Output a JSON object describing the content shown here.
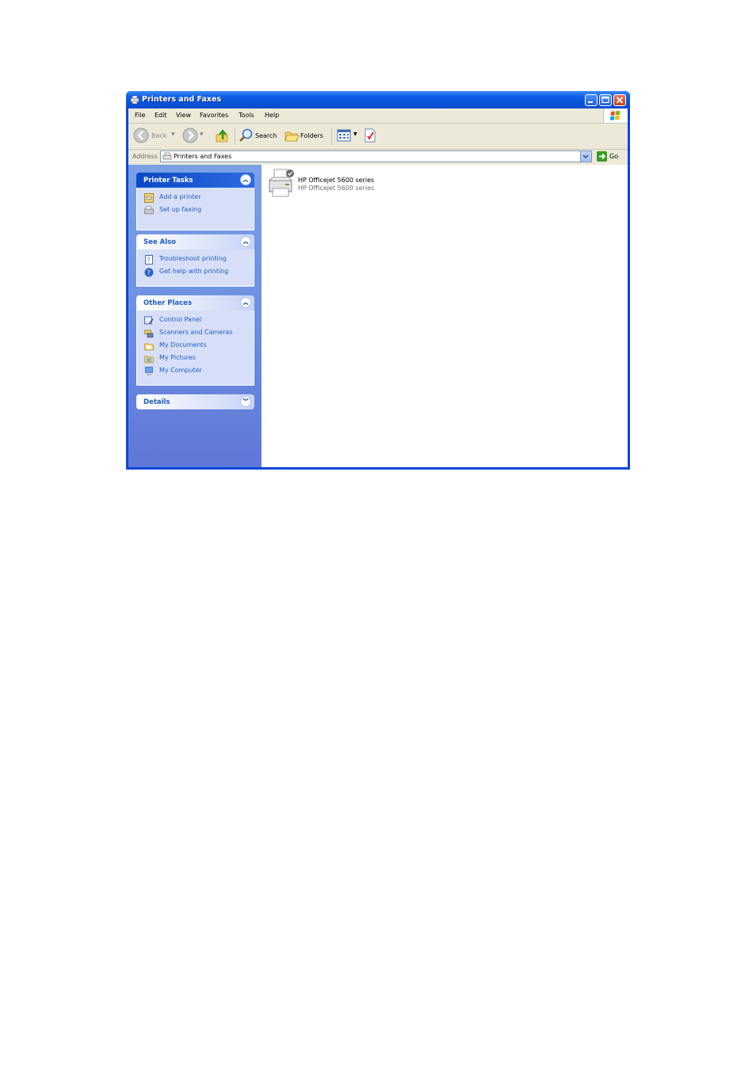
{
  "window": {
    "title": "Printers and Faxes"
  },
  "menu": [
    "File",
    "Edit",
    "View",
    "Favorites",
    "Tools",
    "Help"
  ],
  "toolbar": {
    "back": "Back",
    "search": "Search",
    "folders": "Folders"
  },
  "address": {
    "label": "Address",
    "value": "Printers and Faxes",
    "go": "Go"
  },
  "panels": {
    "printer_tasks": {
      "title": "Printer Tasks",
      "items": [
        "Add a printer",
        "Set up faxing"
      ]
    },
    "see_also": {
      "title": "See Also",
      "items": [
        "Troubleshoot printing",
        "Get help with printing"
      ]
    },
    "other_places": {
      "title": "Other Places",
      "items": [
        "Control Panel",
        "Scanners and Cameras",
        "My Documents",
        "My Pictures",
        "My Computer"
      ]
    },
    "details": {
      "title": "Details"
    }
  },
  "printer": {
    "name": "HP Officejet 5600 series",
    "subtitle": "HP Officejet 5600 series"
  },
  "icons": [
    "printer-fax-icon",
    "minimize-icon",
    "maximize-icon",
    "close-icon",
    "windows-logo-icon",
    "back-icon",
    "forward-icon",
    "up-folder-icon",
    "search-icon",
    "folders-icon",
    "views-icon",
    "sync-icon",
    "go-arrow-icon"
  ],
  "colors": {
    "title_bar": "#0a4ad0",
    "task_link": "#215dc6",
    "pane_bg": "#6c8ee0",
    "client_bg": "#ece9d8"
  }
}
